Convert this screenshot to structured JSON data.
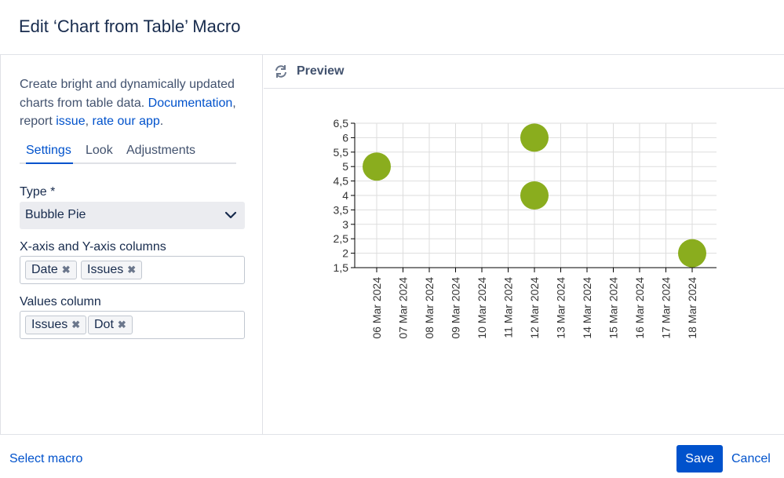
{
  "dialog": {
    "title": "Edit ‘Chart from Table’ Macro"
  },
  "left": {
    "description": {
      "text1": "Create bright and dynamically updated charts from table data. ",
      "link_documentation": "Documentation",
      "text2": ", report ",
      "link_issue": "issue",
      "text3": ", ",
      "link_rate": "rate our app",
      "text4": "."
    },
    "tabs": [
      {
        "label": "Settings",
        "active": true
      },
      {
        "label": "Look",
        "active": false
      },
      {
        "label": "Adjustments",
        "active": false
      }
    ],
    "type_label": "Type *",
    "type_value": "Bubble Pie",
    "xy_label": "X-axis and Y-axis columns",
    "xy_chips": [
      "Date",
      "Issues"
    ],
    "values_label": "Values column",
    "values_chips": [
      "Issues",
      "Dot"
    ]
  },
  "preview": {
    "label": "Preview"
  },
  "chart_data": {
    "type": "scatter",
    "subtype": "bubble",
    "x_categories": [
      "06 Mar 2024",
      "07 Mar 2024",
      "08 Mar 2024",
      "09 Mar 2024",
      "10 Mar 2024",
      "11 Mar 2024",
      "12 Mar 2024",
      "13 Mar 2024",
      "14 Mar 2024",
      "15 Mar 2024",
      "16 Mar 2024",
      "17 Mar 2024",
      "18 Mar 2024"
    ],
    "y_ticks": [
      "1,5",
      "2",
      "2,5",
      "3",
      "3,5",
      "4",
      "4,5",
      "5",
      "5,5",
      "6",
      "6,5"
    ],
    "ylim": [
      1.5,
      6.5
    ],
    "points": [
      {
        "x": "06 Mar 2024",
        "y": 5
      },
      {
        "x": "12 Mar 2024",
        "y": 6
      },
      {
        "x": "12 Mar 2024",
        "y": 4
      },
      {
        "x": "18 Mar 2024",
        "y": 2
      }
    ],
    "bubble_color": "#8aad1e",
    "grid": true
  },
  "footer": {
    "select_macro": "Select macro",
    "save": "Save",
    "cancel": "Cancel"
  }
}
